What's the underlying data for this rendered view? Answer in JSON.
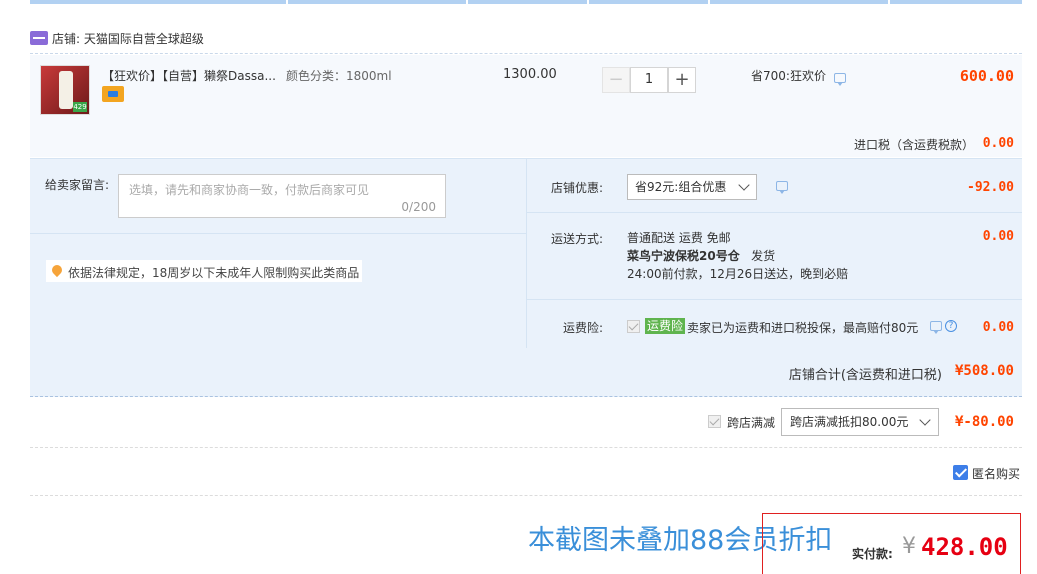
{
  "shop": {
    "label": "店铺: 天猫国际自营全球超级"
  },
  "item": {
    "title": "【狂欢价】【自营】獭祭Dassa...",
    "attr": "颜色分类：1800ml",
    "price": "1300.00",
    "quantity": "1",
    "minus_label": "−",
    "plus_label": "+",
    "promo": "省700:狂欢价",
    "total": "600.00",
    "tax_label": "进口税（含运费税款）",
    "tax_value": "0.00"
  },
  "message": {
    "label": "给卖家留言:",
    "placeholder": "选填，请先和商家协商一致，付款后商家可见",
    "count": "0/200"
  },
  "law_notice": "依据法律规定，18周岁以下未成年人限制购买此类商品",
  "store_discount": {
    "label": "店铺优惠:",
    "selected": "省92元:组合优惠",
    "value": "-92.00"
  },
  "shipping": {
    "label": "运送方式:",
    "line1": "普通配送 运费 免邮",
    "line2_bold": "菜鸟宁波保税20号仓",
    "line2_rest": "发货",
    "line3": "24:00前付款，12月26日送达，晚到必赔",
    "value": "0.00"
  },
  "insurance": {
    "label": "运费险:",
    "badge": "运费险",
    "text": "卖家已为运费和进口税投保，最高赔付80元",
    "help": "?",
    "value": "0.00"
  },
  "shop_total": {
    "label": "店铺合计(含运费和进口税)",
    "value": "¥508.00"
  },
  "cross_store": {
    "label": "跨店满减",
    "selected": "跨店满减抵扣80.00元",
    "value": "¥-80.00"
  },
  "anonymous": {
    "label": "匿名购买",
    "checked": true
  },
  "overlay_note": "本截图未叠加88会员折扣",
  "payment": {
    "label": "实付款:",
    "currency": "¥",
    "value": "428.00"
  },
  "colors": {
    "accent_red": "#f40",
    "pay_red": "#e60012",
    "link_blue": "#3a8fd9",
    "panel_blue": "#eaf2fb"
  }
}
